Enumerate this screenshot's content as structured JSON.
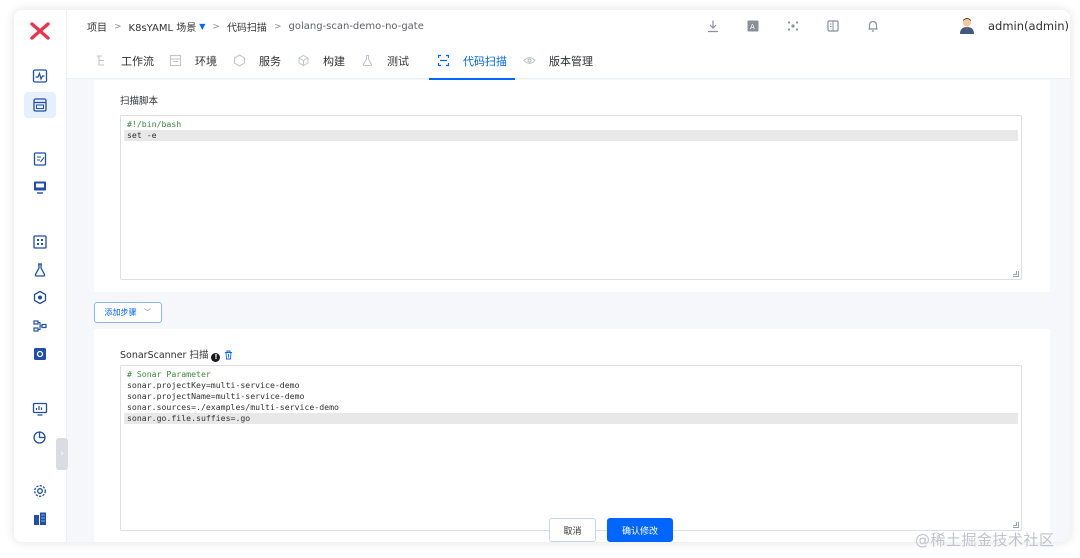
{
  "breadcrumb": {
    "items": [
      "项目",
      "K8sYAML 场景",
      "代码扫描",
      "golang-scan-demo-no-gate"
    ],
    "separator": ">"
  },
  "header": {
    "user_name": "admin(admin)"
  },
  "tabs": [
    {
      "label": "工作流",
      "icon": "workflow-icon",
      "active": false
    },
    {
      "label": "环境",
      "icon": "environment-icon",
      "active": false
    },
    {
      "label": "服务",
      "icon": "service-icon",
      "active": false
    },
    {
      "label": "构建",
      "icon": "build-icon",
      "active": false
    },
    {
      "label": "测试",
      "icon": "test-flask-icon",
      "active": false
    },
    {
      "label": "代码扫描",
      "icon": "code-scan-icon",
      "active": true
    },
    {
      "label": "版本管理",
      "icon": "version-icon",
      "active": false
    }
  ],
  "scan_script": {
    "label": "扫描脚本",
    "lines": [
      "#!/bin/bash",
      "set -e"
    ]
  },
  "add_step": {
    "label": "添加步骤"
  },
  "sonar": {
    "label": "SonarScanner 扫描",
    "info": "!",
    "lines": [
      "# Sonar Parameter",
      "sonar.projectKey=multi-service-demo",
      "sonar.projectName=multi-service-demo",
      "sonar.sources=./examples/multi-service-demo",
      "sonar.go.file.suffies=.go"
    ]
  },
  "actions": {
    "cancel": "取消",
    "confirm": "确认修改"
  },
  "watermark": "@稀土掘金技术社区",
  "colors": {
    "accent": "#0066ff",
    "logo": "#e8344e",
    "comment": "#3b8a3b",
    "active_tab_bg": "#e6effc"
  }
}
